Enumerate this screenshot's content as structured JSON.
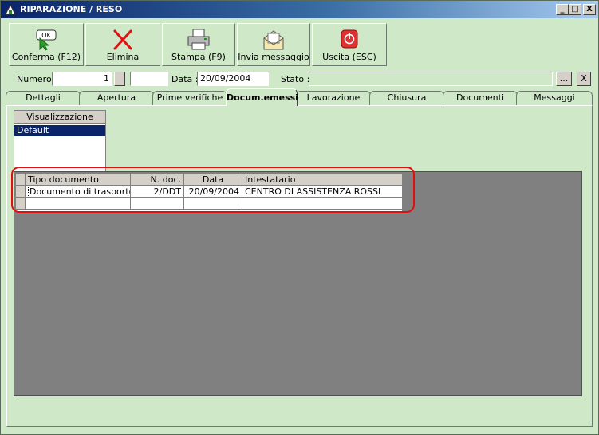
{
  "window": {
    "title": "RIPARAZIONE / RESO",
    "controls": {
      "minimize": "_",
      "maximize": "□",
      "close": "X"
    }
  },
  "toolbar": [
    {
      "label": "Conferma (F12)",
      "icon": "ok-icon"
    },
    {
      "label": "Elimina",
      "icon": "delete-x-icon"
    },
    {
      "label": "Stampa (F9)",
      "icon": "printer-icon"
    },
    {
      "label": "Invia messaggio",
      "icon": "envelope-icon"
    },
    {
      "label": "Uscita (ESC)",
      "icon": "power-icon"
    }
  ],
  "ok_icon_text": "OK",
  "fields": {
    "numero_label": "Numero :",
    "numero_value": "1",
    "numero_suffix": "",
    "data_label": "Data :",
    "data_value": "20/09/2004",
    "stato_label": "Stato :",
    "stato_value": "",
    "stato_browse": "...",
    "stato_clear": "X"
  },
  "tabs": [
    {
      "label": "Dettagli"
    },
    {
      "label": "Apertura"
    },
    {
      "label": "Prime verifiche"
    },
    {
      "label": "Docum.emessi",
      "active": true
    },
    {
      "label": "Lavorazione"
    },
    {
      "label": "Chiusura"
    },
    {
      "label": "Documenti"
    },
    {
      "label": "Messaggi"
    }
  ],
  "visualizzazione": {
    "header": "Visualizzazione",
    "items": [
      "Default"
    ]
  },
  "documents": {
    "columns": [
      "Tipo documento",
      "N. doc.",
      "Data",
      "Intestatario"
    ],
    "rows": [
      [
        "Documento di trasporto",
        "2/DDT",
        "20/09/2004",
        "CENTRO DI ASSISTENZA ROSSI"
      ]
    ]
  },
  "colors": {
    "background": "#cfe8c8",
    "highlight": "#e01010",
    "selection": "#0a246a",
    "gray_area": "#808080"
  }
}
